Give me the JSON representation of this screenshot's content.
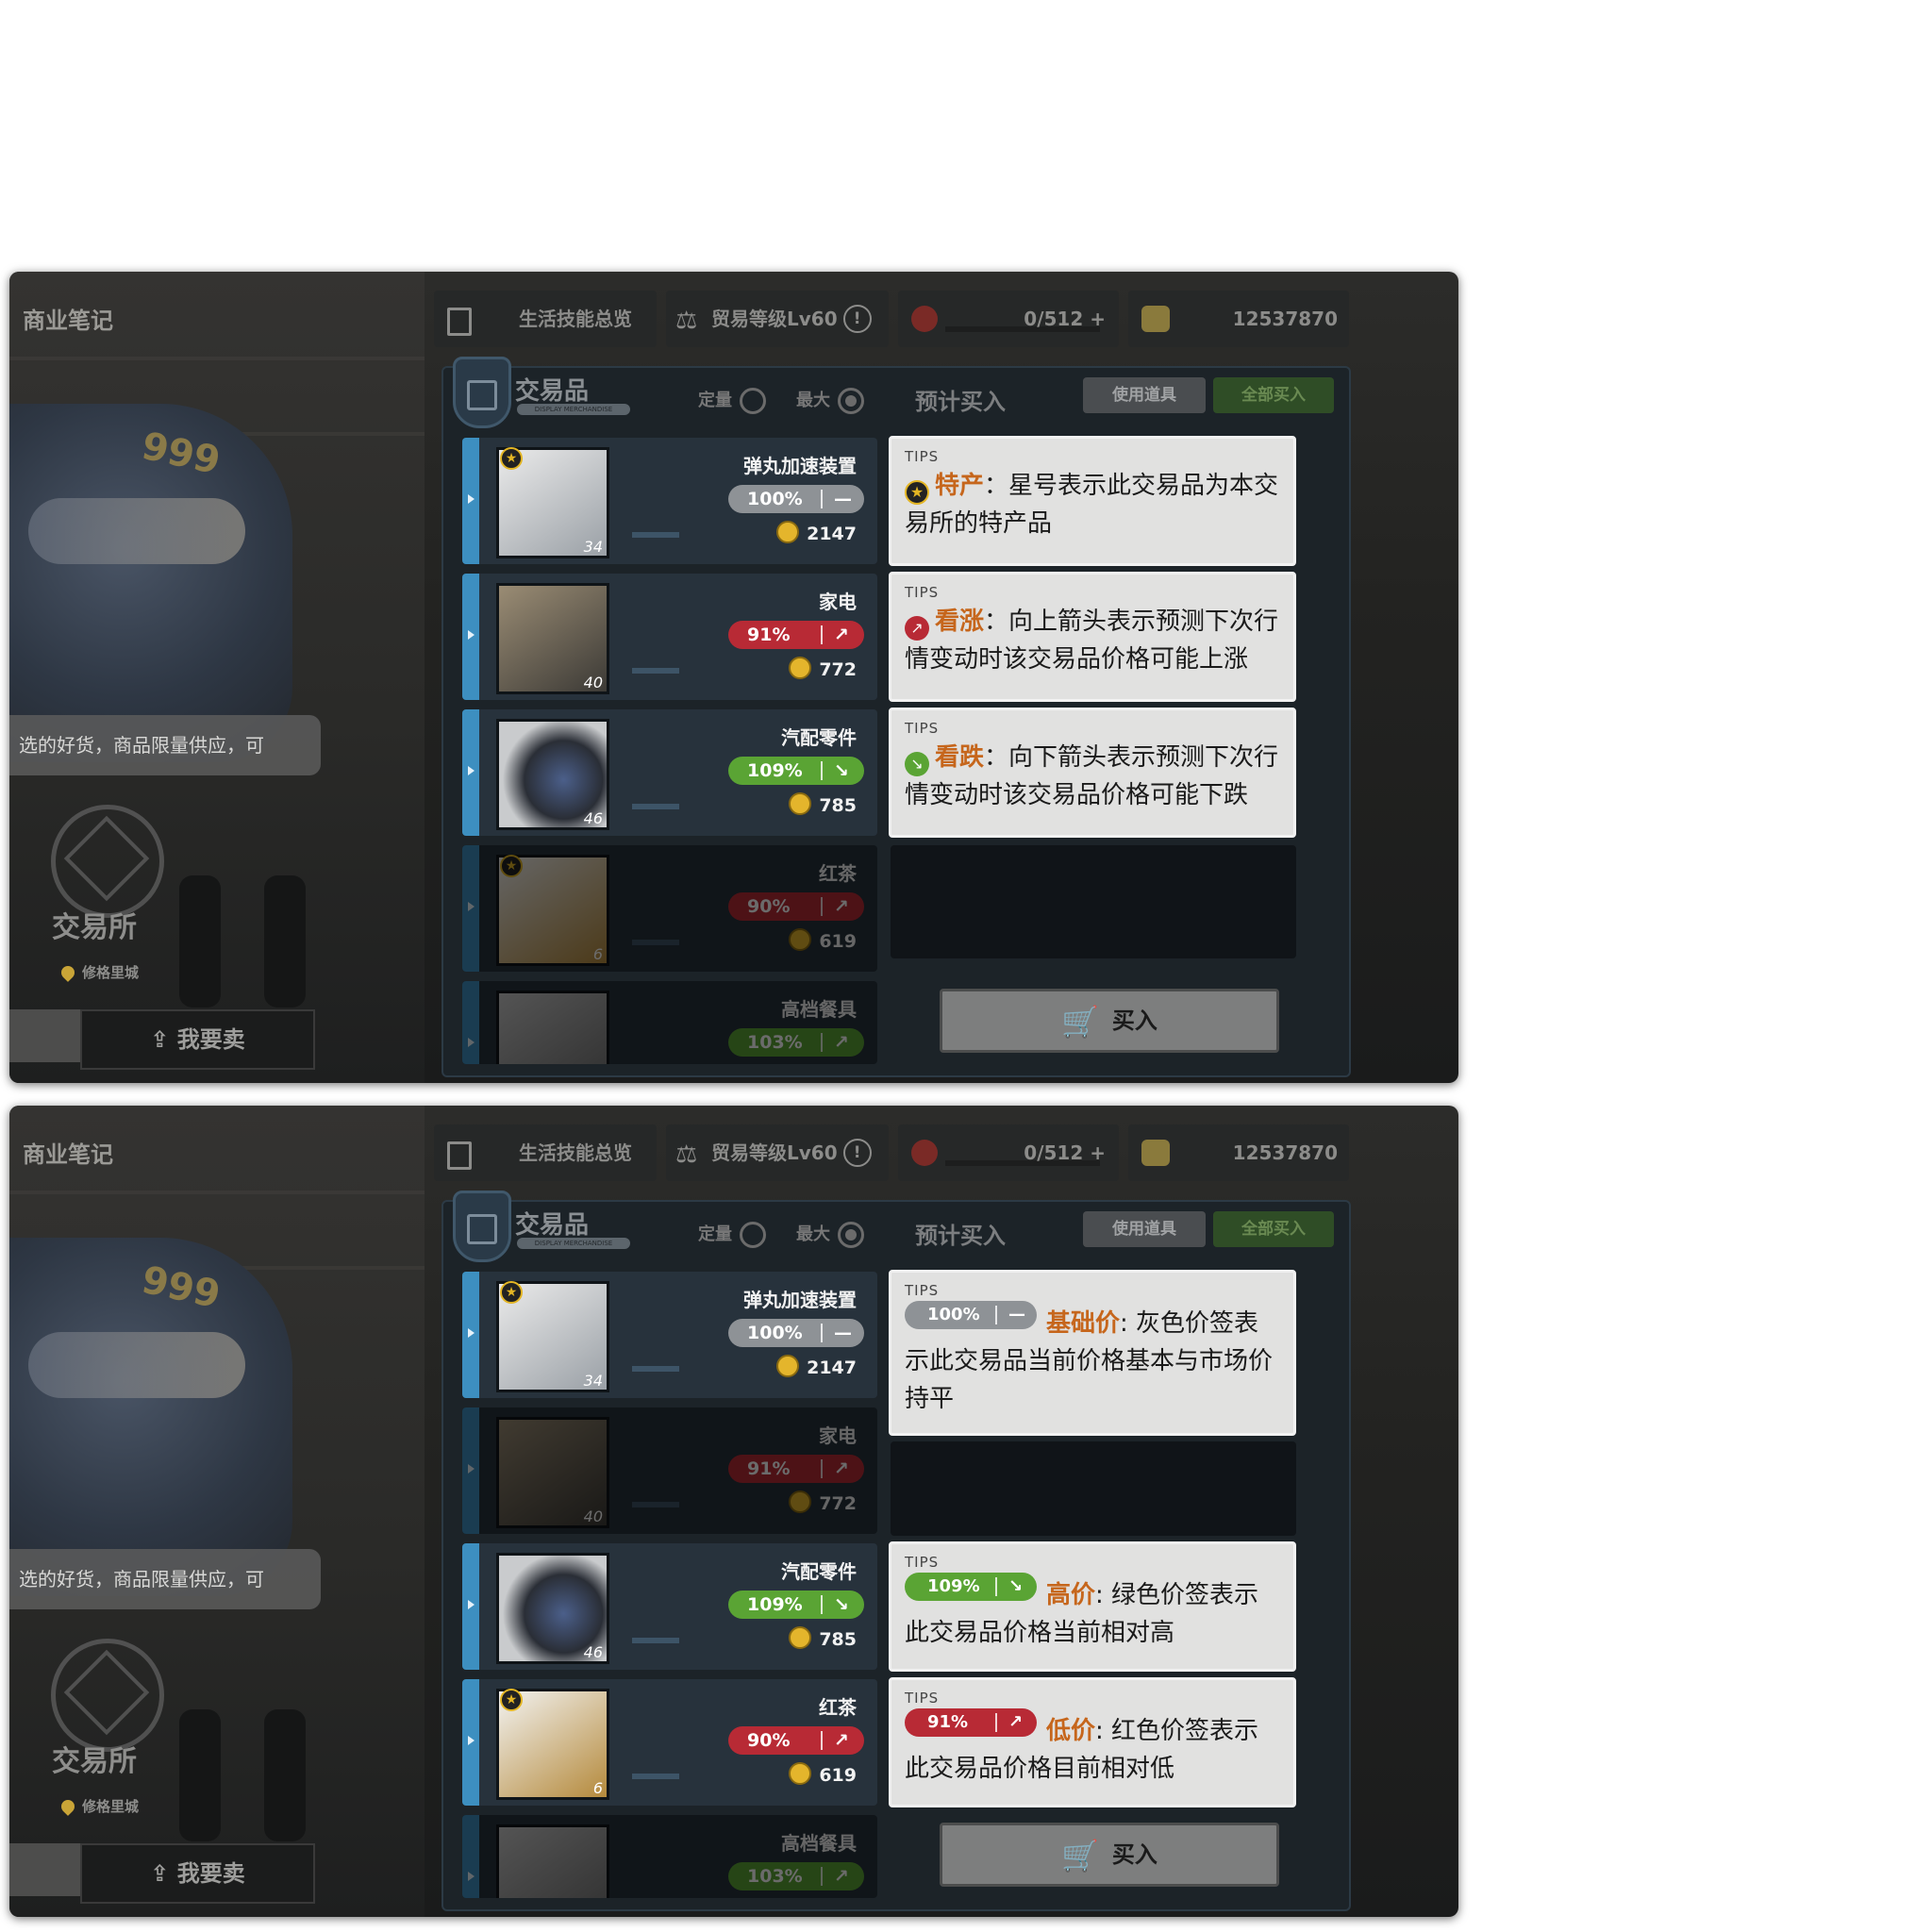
{
  "sidebar": {
    "notes_label": "商业笔记",
    "mascot_tag": "999",
    "bubble_text": "选的好货，商品限量供应，可",
    "exchange_title": "交易所",
    "location": "修格里城",
    "sell_label": "我要卖"
  },
  "topbar": {
    "skills_label": "生活技能总览",
    "trade_level": "贸易等级Lv60",
    "capacity": "0/512",
    "plus": "+",
    "gold": "12537870"
  },
  "header": {
    "title": "交易品",
    "title_en": "DISPLAY MERCHANDISE",
    "mode_fixed": "定量",
    "mode_max": "最大",
    "estimate": "预计买入",
    "use_item": "使用道具",
    "buy_all": "全部买入",
    "buy": "买入"
  },
  "items": [
    {
      "name": "弹丸加速装置",
      "pct": "100%",
      "arrow": "—",
      "price": "2147",
      "stock": "34",
      "star": true,
      "tone": "gray"
    },
    {
      "name": "家电",
      "pct": "91%",
      "arrow": "↗",
      "price": "772",
      "stock": "40",
      "star": false,
      "tone": "red"
    },
    {
      "name": "汽配零件",
      "pct": "109%",
      "arrow": "↘",
      "price": "785",
      "stock": "46",
      "star": false,
      "tone": "green"
    },
    {
      "name": "红茶",
      "pct": "90%",
      "arrow": "↗",
      "price": "619",
      "stock": "6",
      "star": true,
      "tone": "red"
    },
    {
      "name": "高档餐具",
      "pct": "103%",
      "arrow": "↗",
      "price": "",
      "stock": "",
      "star": false,
      "tone": "green"
    }
  ],
  "tips_panel1": {
    "label": "TIPS",
    "special_kw": "特产",
    "special_text": "：星号表示此交易品为本交易所的特产品",
    "rise_kw": "看涨",
    "rise_text": "：向上箭头表示预测下次行情变动时该交易品价格可能上涨",
    "fall_kw": "看跌",
    "fall_text": "：向下箭头表示预测下次行情变动时该交易品价格可能下跌"
  },
  "tips_panel2": {
    "label": "TIPS",
    "base_pct": "100%",
    "base_kw": "基础价",
    "base_text": ": 灰色价签表示此交易品当前价格基本与市场价持平",
    "high_pct": "109%",
    "high_kw": "高价",
    "high_text": ": 绿色价签表示此交易品价格当前相对高",
    "low_pct": "91%",
    "low_kw": "低价",
    "low_text": ": 红色价签表示此交易品价格目前相对低"
  },
  "colors": {
    "gray_tag": "#8e9296",
    "red_tag": "#b82a35",
    "green_tag": "#5aa434",
    "keyword": "#c6661c",
    "accent": "#3d8fc0"
  },
  "icons": [
    "shopping-bag-icon",
    "scale-icon",
    "coin-icon",
    "cart-icon",
    "star-icon",
    "arrow-up-icon",
    "arrow-down-icon",
    "location-pin-icon",
    "upload-icon"
  ]
}
